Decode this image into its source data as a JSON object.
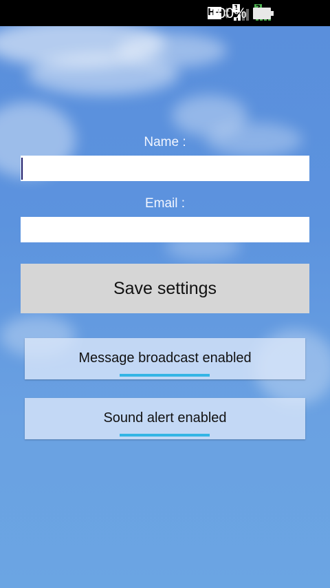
{
  "status_bar": {
    "network_type": "H+",
    "sim1_label": "1",
    "sim2_label": "2",
    "battery_percent": "100%",
    "icons": [
      "hplus-icon",
      "data-activity-icon",
      "sim1-signal-icon",
      "sim2-signal-icon",
      "battery-icon"
    ]
  },
  "form": {
    "name_label": "Name :",
    "name_value": "",
    "email_label": "Email :",
    "email_value": "",
    "save_label": "Save settings"
  },
  "toggles": [
    {
      "label": "Message broadcast enabled",
      "checked": true
    },
    {
      "label": "Sound alert enabled",
      "checked": true
    }
  ],
  "colors": {
    "background": "#5c93de",
    "toggle_indicator": "#33b5e5",
    "save_button": "#d6d6d6",
    "sim2_signal": "#4caf50"
  }
}
